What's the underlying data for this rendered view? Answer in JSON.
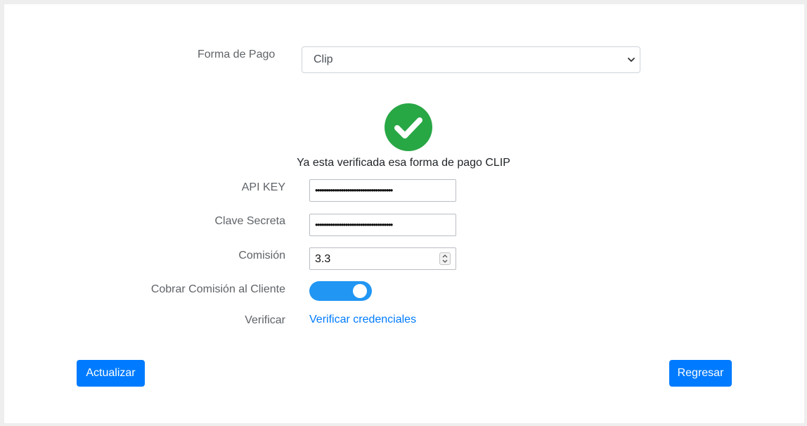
{
  "form": {
    "payment_method_label": "Forma de Pago",
    "payment_method_value": "Clip",
    "verified_message": "Ya esta verificada esa forma de pago CLIP",
    "api_key_label": "API KEY",
    "api_key_value": "••••••••••••••••••••••••••••••••••••",
    "secret_key_label": "Clave Secreta",
    "secret_key_value": "••••••••••••••••••••••••••••••••••••",
    "commission_label": "Comisión",
    "commission_value": "3.3",
    "charge_commission_label": "Cobrar Comisión al Cliente",
    "charge_commission_enabled": true,
    "verify_label": "Verificar",
    "verify_link": "Verificar credenciales"
  },
  "actions": {
    "update_label": "Actualizar",
    "back_label": "Regresar"
  },
  "colors": {
    "primary": "#007bff",
    "success": "#28a745",
    "toggle_on": "#2196f3"
  },
  "icons": {
    "verified": "check-circle-icon",
    "select_arrow": "chevron-down-icon"
  }
}
